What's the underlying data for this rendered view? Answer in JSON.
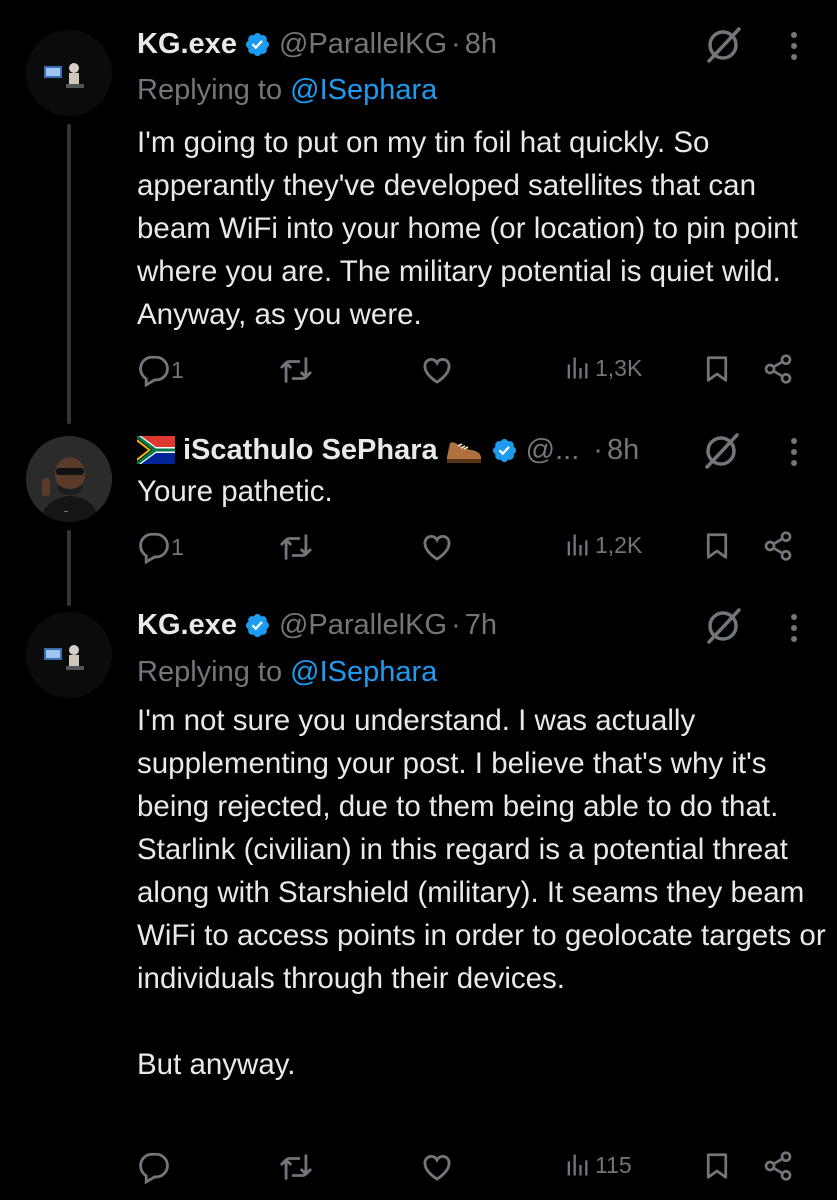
{
  "tweets": [
    {
      "name": "KG.exe",
      "handle": "@ParallelKG",
      "dot": "·",
      "time": "8h",
      "replying_prefix": "Replying to ",
      "replying_to": "@ISephara",
      "text": "I'm going to put on my tin foil hat quickly. So apperantly they've developed satellites that can beam WiFi into your home (or location) to pin point where you are. The military potential is quiet wild. Anyway, as you were.",
      "replies": "1",
      "views": "1,3K"
    },
    {
      "name": "iScathulo SePhara",
      "handle": "@...",
      "dot": "·",
      "time": "8h",
      "text": "Youre pathetic.",
      "replies": "1",
      "views": "1,2K"
    },
    {
      "name": "KG.exe",
      "handle": "@ParallelKG",
      "dot": "·",
      "time": "7h",
      "replying_prefix": "Replying to ",
      "replying_to": "@ISephara",
      "text": "I'm not sure you understand. I was actually supplementing your post. I believe that's why it's being rejected, due to them being able to do that. Starlink (civilian) in this regard is a potential threat along with Starshield (military). It seams they beam WiFi to access points in order to geolocate targets or individuals through their devices.\n\nBut anyway.",
      "replies": "",
      "views": "115"
    }
  ],
  "colors": {
    "background": "#000000",
    "text": "#e7e9ea",
    "muted": "#71767b",
    "link": "#1d9bf0",
    "verified": "#1d9bf0"
  },
  "icons": [
    "reply-icon",
    "retweet-icon",
    "like-icon",
    "views-icon",
    "bookmark-icon",
    "share-icon",
    "grok-icon",
    "more-icon",
    "verified-badge-icon",
    "south-africa-flag-icon",
    "shoe-emoji-icon"
  ]
}
